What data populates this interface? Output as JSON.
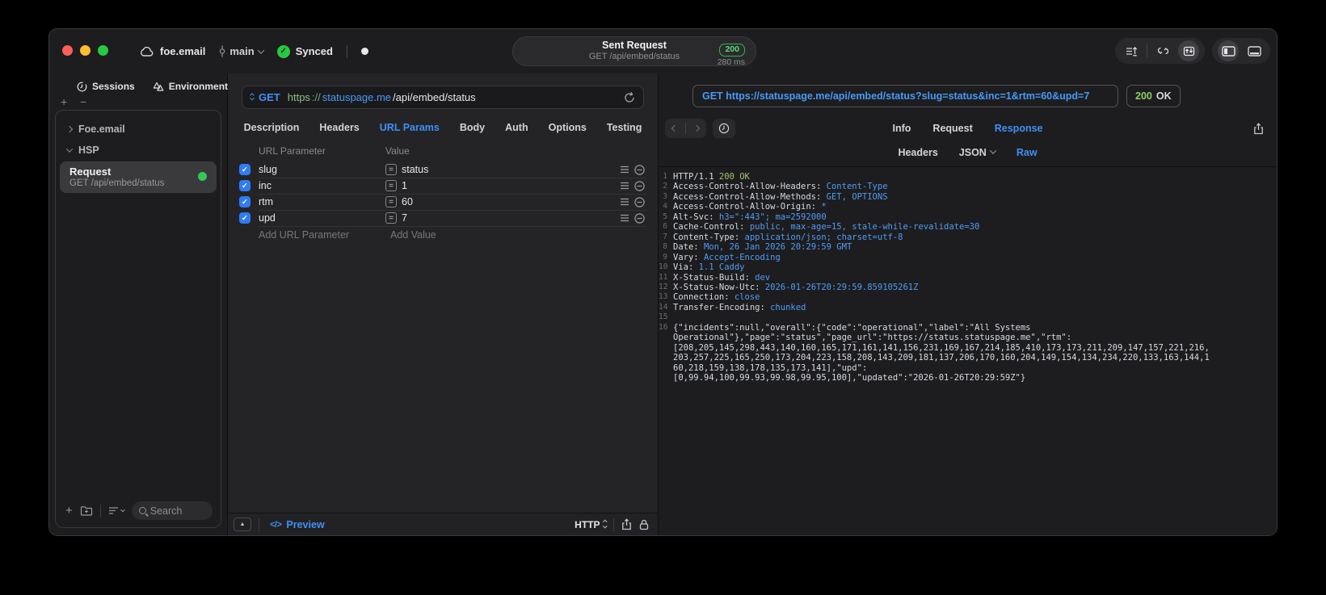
{
  "colors": {
    "accent_blue": "#3f8ff7",
    "success_green": "#30d158",
    "badge_green": "#5dd879",
    "code_value_blue": "#4f9cf7",
    "code_green": "#9dc56a",
    "url_scheme_green": "#8fbf7f",
    "checkbox_blue": "#2e7cf6"
  },
  "glyphs": {
    "check": "✓",
    "plus": "+",
    "minus": "−",
    "triangle_up": "▲",
    "equals": "=",
    "code": "</>"
  },
  "titlebar": {
    "project": "foe.email",
    "branch": "main",
    "sync_status": "Synced",
    "request_title": "Sent Request",
    "request_subtitle": "GET /api/embed/status",
    "status_code": "200",
    "duration": "280 ms"
  },
  "sidebar": {
    "tabs": [
      {
        "label": "Sessions"
      },
      {
        "label": "Environments"
      }
    ],
    "groups": [
      {
        "label": "Foe.email",
        "expanded": false
      },
      {
        "label": "HSP",
        "expanded": true
      }
    ],
    "request_item": {
      "title": "Request",
      "subtitle": "GET /api/embed/status"
    },
    "search_placeholder": "Search"
  },
  "request_panel": {
    "method": "GET",
    "url": {
      "scheme": "https",
      "separator": "://",
      "host": "statuspage.me",
      "path": "/api/embed/status"
    },
    "tabs": [
      "Description",
      "Headers",
      "URL Params",
      "Body",
      "Auth",
      "Options",
      "Testing"
    ],
    "active_tab": "URL Params",
    "params": {
      "columns": [
        "URL Parameter",
        "Value"
      ],
      "rows": [
        {
          "name": "slug",
          "value": "status",
          "enabled": true
        },
        {
          "name": "inc",
          "value": "1",
          "enabled": true
        },
        {
          "name": "rtm",
          "value": "60",
          "enabled": true
        },
        {
          "name": "upd",
          "value": "7",
          "enabled": true
        }
      ],
      "add_name": "Add URL Parameter",
      "add_value": "Add Value"
    },
    "footer": {
      "preview": "Preview",
      "protocol": "HTTP"
    }
  },
  "response_panel": {
    "request_line": "GET https://statuspage.me/api/embed/status?slug=status&inc=1&rtm=60&upd=7",
    "status_code": "200",
    "status_text": "OK",
    "tabs": [
      "Info",
      "Request",
      "Response"
    ],
    "active_tab": "Response",
    "subtabs": [
      "Headers",
      "JSON",
      "Raw"
    ],
    "active_subtab": "Raw",
    "body": {
      "header_lines": [
        {
          "n": "1",
          "name": "HTTP/1.1 ",
          "value": "200 OK",
          "green": true
        },
        {
          "n": "2",
          "name": "Access-Control-Allow-Headers: ",
          "value": "Content-Type"
        },
        {
          "n": "3",
          "name": "Access-Control-Allow-Methods: ",
          "value": "GET, OPTIONS"
        },
        {
          "n": "4",
          "name": "Access-Control-Allow-Origin: ",
          "value": "*"
        },
        {
          "n": "5",
          "name": "Alt-Svc: ",
          "value": "h3=\":443\"; ma=2592000"
        },
        {
          "n": "6",
          "name": "Cache-Control: ",
          "value": "public, max-age=15, stale-while-revalidate=30"
        },
        {
          "n": "7",
          "name": "Content-Type: ",
          "value": "application/json; charset=utf-8"
        },
        {
          "n": "8",
          "name": "Date: ",
          "value": "Mon, 26 Jan 2026 20:29:59 GMT"
        },
        {
          "n": "9",
          "name": "Vary: ",
          "value": "Accept-Encoding"
        },
        {
          "n": "10",
          "name": "Via: ",
          "value": "1.1 Caddy"
        },
        {
          "n": "11",
          "name": "X-Status-Build: ",
          "value": "dev"
        },
        {
          "n": "12",
          "name": "X-Status-Now-Utc: ",
          "value": "2026-01-26T20:29:59.859105261Z"
        },
        {
          "n": "13",
          "name": "Connection: ",
          "value": "close"
        },
        {
          "n": "14",
          "name": "Transfer-Encoding: ",
          "value": "chunked"
        },
        {
          "n": "15",
          "name": "",
          "value": ""
        }
      ],
      "json_lines": [
        {
          "n": "16",
          "text": "{\"incidents\":null,\"overall\":{\"code\":\"operational\",\"label\":\"All Systems"
        },
        {
          "n": "",
          "text": "Operational\"},\"page\":\"status\",\"page_url\":\"https://status.statuspage.me\",\"rtm\":"
        },
        {
          "n": "",
          "text": "[208,205,145,298,443,140,160,165,171,161,141,156,231,169,167,214,185,410,173,173,211,209,147,157,221,216,"
        },
        {
          "n": "",
          "text": "203,257,225,165,250,173,204,223,158,208,143,209,181,137,206,170,160,204,149,154,134,234,220,133,163,144,1"
        },
        {
          "n": "",
          "text": "60,218,159,138,178,135,173,141],\"upd\":"
        },
        {
          "n": "",
          "text": "[0,99.94,100,99.93,99.98,99.95,100],\"updated\":\"2026-01-26T20:29:59Z\"}"
        }
      ]
    }
  }
}
